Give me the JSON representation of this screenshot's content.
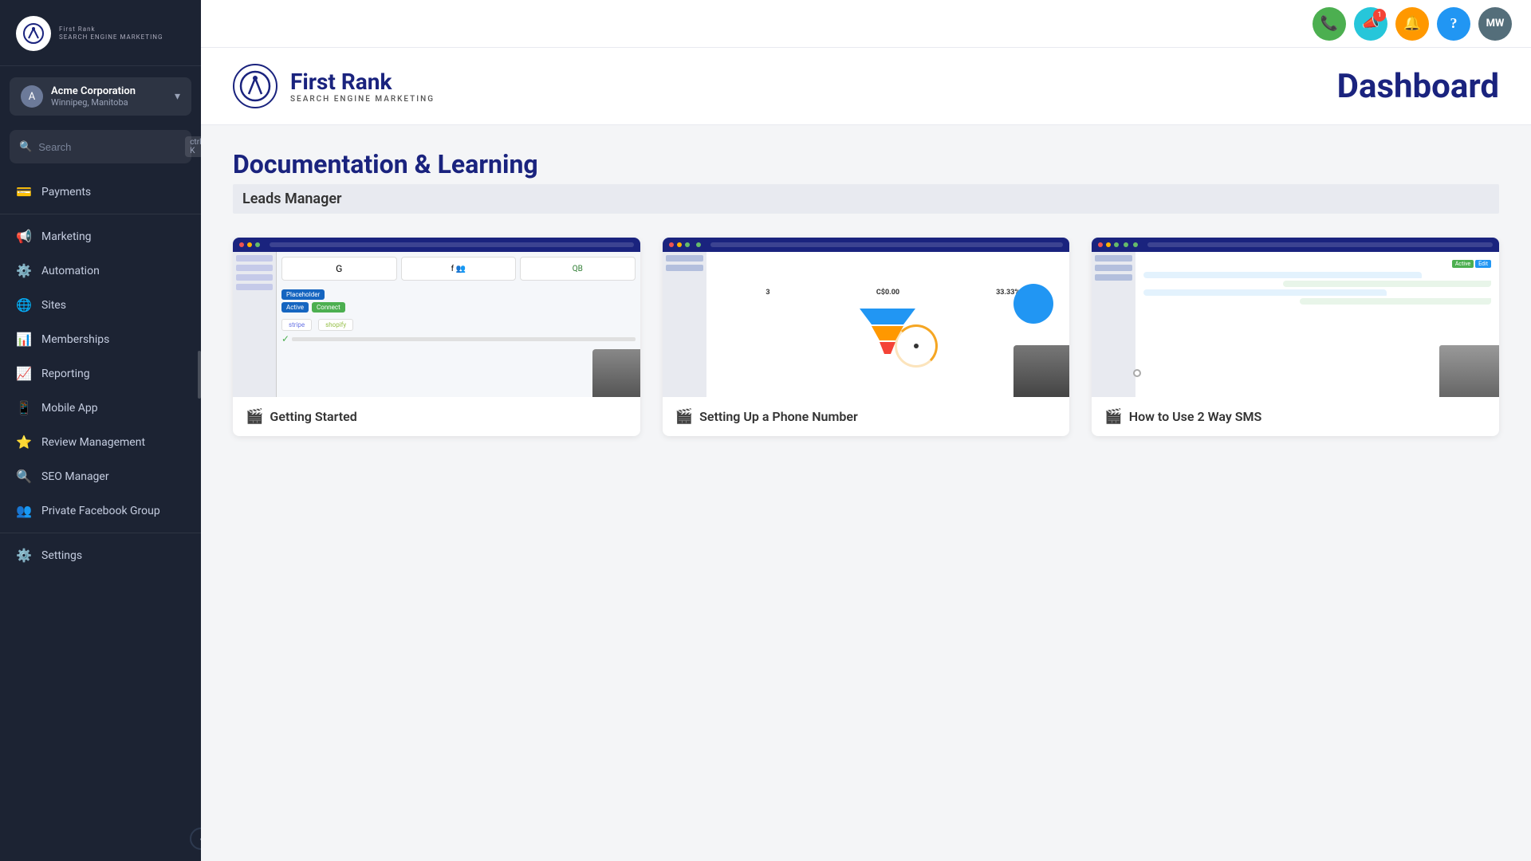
{
  "sidebar": {
    "logo": {
      "main": "First Rank",
      "sub": "SEARCH ENGINE MARKETING"
    },
    "account": {
      "name": "Acme Corporation",
      "location": "Winnipeg, Manitoba"
    },
    "search": {
      "placeholder": "Search",
      "shortcut": "ctrl K"
    },
    "nav_items": [
      {
        "id": "payments",
        "label": "Payments",
        "icon": "💳"
      },
      {
        "id": "marketing",
        "label": "Marketing",
        "icon": "📢"
      },
      {
        "id": "automation",
        "label": "Automation",
        "icon": "⚙️"
      },
      {
        "id": "sites",
        "label": "Sites",
        "icon": "🌐"
      },
      {
        "id": "memberships",
        "label": "Memberships",
        "icon": "📊"
      },
      {
        "id": "reporting",
        "label": "Reporting",
        "icon": "📈"
      },
      {
        "id": "mobile-app",
        "label": "Mobile App",
        "icon": "📱"
      },
      {
        "id": "review-management",
        "label": "Review Management",
        "icon": "⭐"
      },
      {
        "id": "seo-manager",
        "label": "SEO Manager",
        "icon": "🔍"
      },
      {
        "id": "private-facebook-group",
        "label": "Private Facebook Group",
        "icon": "👥"
      },
      {
        "id": "settings",
        "label": "Settings",
        "icon": "⚙️"
      }
    ],
    "collapse_icon": "‹"
  },
  "header": {
    "icons": [
      {
        "id": "phone",
        "symbol": "📞",
        "color": "green",
        "label": "Phone"
      },
      {
        "id": "megaphone",
        "symbol": "📣",
        "color": "teal",
        "label": "Announcements",
        "badge": "1"
      },
      {
        "id": "bell",
        "symbol": "🔔",
        "color": "orange",
        "label": "Notifications"
      },
      {
        "id": "help",
        "symbol": "?",
        "color": "blue",
        "label": "Help"
      },
      {
        "id": "avatar",
        "symbol": "MW",
        "color": "avatar",
        "label": "User Avatar"
      }
    ]
  },
  "dashboard": {
    "brand": {
      "main_name": "First Rank",
      "sub_name": "SEARCH ENGINE MARKETING"
    },
    "title": "Dashboard",
    "doc_section": "Documentation & Learning",
    "leads_manager": "Leads Manager"
  },
  "cards": [
    {
      "id": "getting-started",
      "title": "Getting Started",
      "icon": "🎬",
      "thumb_type": "1"
    },
    {
      "id": "setting-up-phone",
      "title": "Setting Up a Phone Number",
      "icon": "🎬",
      "thumb_type": "2"
    },
    {
      "id": "2way-sms",
      "title": "How to Use 2 Way SMS",
      "icon": "🎬",
      "thumb_type": "3"
    }
  ]
}
